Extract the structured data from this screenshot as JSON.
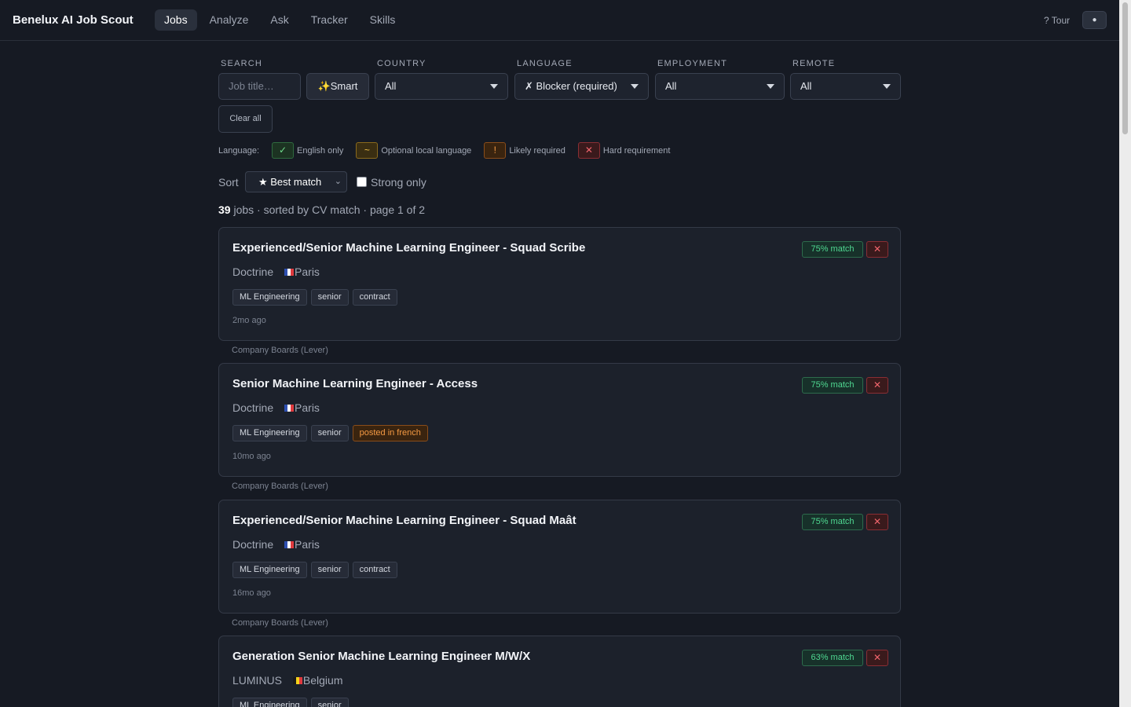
{
  "app": {
    "title": "Benelux AI Job Scout",
    "nav": [
      {
        "label": "Jobs",
        "active": true
      },
      {
        "label": "Analyze"
      },
      {
        "label": "Ask"
      },
      {
        "label": "Tracker"
      },
      {
        "label": "Skills"
      }
    ],
    "tour_label": "? Tour",
    "theme_icon": "sun-icon"
  },
  "filters": {
    "search": {
      "label": "SEARCH",
      "placeholder": "Job title…",
      "smart_label": "✨Smart"
    },
    "country": {
      "label": "COUNTRY",
      "value": "All"
    },
    "language": {
      "label": "LANGUAGE",
      "value": "✗ Blocker (required)"
    },
    "employment": {
      "label": "EMPLOYMENT",
      "value": "All"
    },
    "remote": {
      "label": "REMOTE",
      "value": "All"
    },
    "clear_label": "Clear all"
  },
  "legend": {
    "label": "Language:",
    "items": [
      {
        "symbol": "✓",
        "text": "English only"
      },
      {
        "symbol": "~",
        "text": "Optional local language"
      },
      {
        "symbol": "!",
        "text": "Likely required"
      },
      {
        "symbol": "✕",
        "text": "Hard requirement"
      }
    ]
  },
  "sort": {
    "label": "Sort",
    "value": "★ Best match",
    "strong_only_label": "Strong only",
    "strong_only_checked": false
  },
  "summary": {
    "count": "39",
    "text": "jobs · sorted by CV match · page 1 of 2"
  },
  "jobs": [
    {
      "title": "Experienced/Senior Machine Learning Engineer - Squad Scribe",
      "company": "Doctrine",
      "location": "Paris",
      "flag": "fr",
      "tags": [
        {
          "label": "ML Engineering"
        },
        {
          "label": "senior"
        },
        {
          "label": "contract"
        }
      ],
      "age": "2mo ago",
      "match": "75% match",
      "dismiss": "✕",
      "source": "Company Boards (Lever)"
    },
    {
      "title": "Senior Machine Learning Engineer - Access",
      "company": "Doctrine",
      "location": "Paris",
      "flag": "fr",
      "tags": [
        {
          "label": "ML Engineering"
        },
        {
          "label": "senior"
        },
        {
          "label": "posted in french",
          "warn": true
        }
      ],
      "age": "10mo ago",
      "match": "75% match",
      "dismiss": "✕",
      "source": "Company Boards (Lever)"
    },
    {
      "title": "Experienced/Senior Machine Learning Engineer - Squad Maât",
      "company": "Doctrine",
      "location": "Paris",
      "flag": "fr",
      "tags": [
        {
          "label": "ML Engineering"
        },
        {
          "label": "senior"
        },
        {
          "label": "contract"
        }
      ],
      "age": "16mo ago",
      "match": "75% match",
      "dismiss": "✕",
      "source": "Company Boards (Lever)"
    },
    {
      "title": "Generation Senior Machine Learning Engineer M/W/X",
      "company": "LUMINUS",
      "location": "Belgium",
      "flag": "be",
      "tags": [
        {
          "label": "ML Engineering"
        },
        {
          "label": "senior"
        }
      ],
      "age": "",
      "match": "63% match",
      "dismiss": "✕",
      "source": ""
    }
  ]
}
